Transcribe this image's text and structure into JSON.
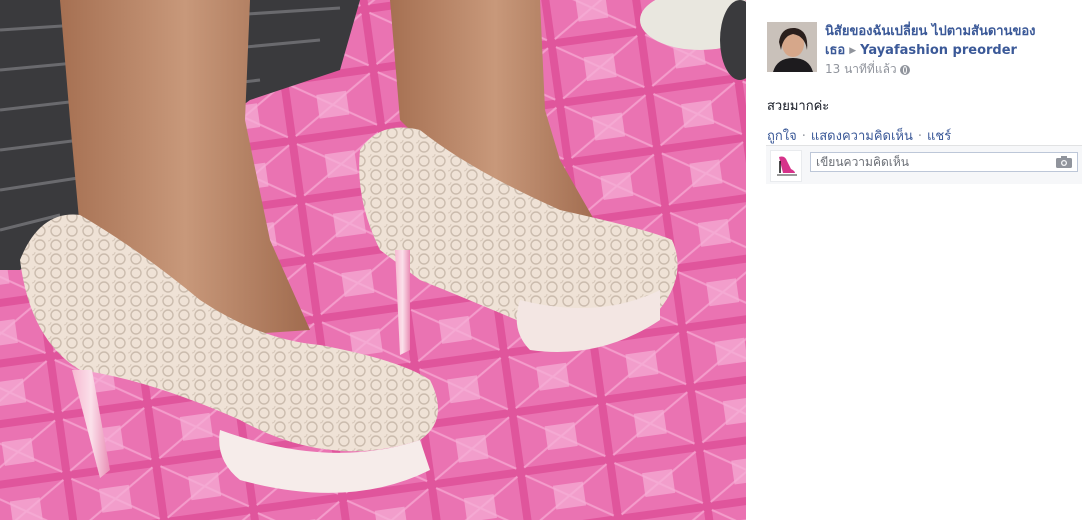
{
  "photo": {
    "description_icon": "photo-of-pink-lace-high-heels",
    "colors": {
      "floor": "#e0559c",
      "floor_light": "#f08cc2",
      "shoe": "#efe4d8",
      "skin": "#b98665"
    }
  },
  "post": {
    "author": "นิสัยของฉันเปลี่ยน ไปตามสันดานของเธอ",
    "page": "Yayafashion preorder",
    "time": "13 นาทีที่แล้ว",
    "caption": "สวยมากค่ะ"
  },
  "actions": {
    "like": "ถูกใจ",
    "comment": "แสดงความคิดเห็น",
    "share": "แชร์",
    "separator": "·"
  },
  "comment": {
    "placeholder": "เขียนความคิดเห็น"
  },
  "colors": {
    "link": "#3b5998",
    "meta": "#90949c",
    "comment_bg": "#f6f7f9"
  }
}
